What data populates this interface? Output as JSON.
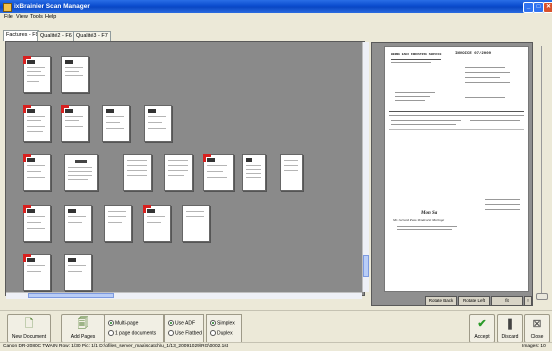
{
  "window": {
    "title": "ixBrainier Scan Manager",
    "minimize": "_",
    "maximize": "□",
    "close": "✕"
  },
  "menu": [
    "File",
    "View",
    "Tools",
    "Help"
  ],
  "tabs": [
    "Factures - F9",
    "Qualité2 - F6",
    "Qualité3 - F7"
  ],
  "preview_buttons": [
    "Rotate Back",
    "Rotate Left",
    "fit",
    "!"
  ],
  "toolbar": {
    "new_document": "New Document",
    "add_pages": "Add Pages",
    "accept": "Accept",
    "discard": "Discard",
    "close": "Close"
  },
  "options": {
    "page_mode": [
      "Multi-page",
      "1 page documents"
    ],
    "page_mode_selected": 0,
    "flatbed": [
      "Use ADF",
      "Use Flatbed"
    ],
    "flatbed_selected": 0,
    "sides": [
      "Simplex",
      "Duplex"
    ],
    "sides_selected": 0
  },
  "status": {
    "left": "Canon DR-2080C TWAIN     Row: 1/30  Pic: 1/1   D:\\ofiles_server_maa\\scatch\\u_1/13_20091029\\RG\\0002.1st",
    "right": "Images: 10"
  },
  "preview_doc": {
    "company": "BERNE EAUX INDUSTRIE SERVICE",
    "doc_number": "INVOICE 07/2009",
    "greeting": "Mon Sa",
    "signature": "Mr. Gérard Pass-Vendeurst Moringe"
  },
  "thumbnail_rows": [
    4,
    7,
    4,
    2
  ]
}
